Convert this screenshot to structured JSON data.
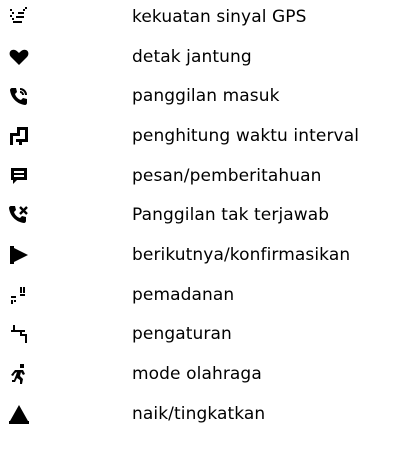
{
  "legend": {
    "items": [
      {
        "icon": "gps-signal-icon",
        "label": "kekuatan sinyal GPS"
      },
      {
        "icon": "heart-icon",
        "label": "detak jantung"
      },
      {
        "icon": "incoming-call-icon",
        "label": "panggilan masuk"
      },
      {
        "icon": "interval-timer-icon",
        "label": "penghitung waktu interval"
      },
      {
        "icon": "message-icon",
        "label": "pesan/pemberitahuan"
      },
      {
        "icon": "missed-call-icon",
        "label": "Panggilan tak terjawab"
      },
      {
        "icon": "next-confirm-icon",
        "label": "berikutnya/konfirmasikan"
      },
      {
        "icon": "pairing-icon",
        "label": "pemadanan"
      },
      {
        "icon": "settings-icon",
        "label": "pengaturan"
      },
      {
        "icon": "sport-mode-icon",
        "label": "mode olahraga"
      },
      {
        "icon": "up-increase-icon",
        "label": "naik/tingkatkan"
      }
    ]
  }
}
